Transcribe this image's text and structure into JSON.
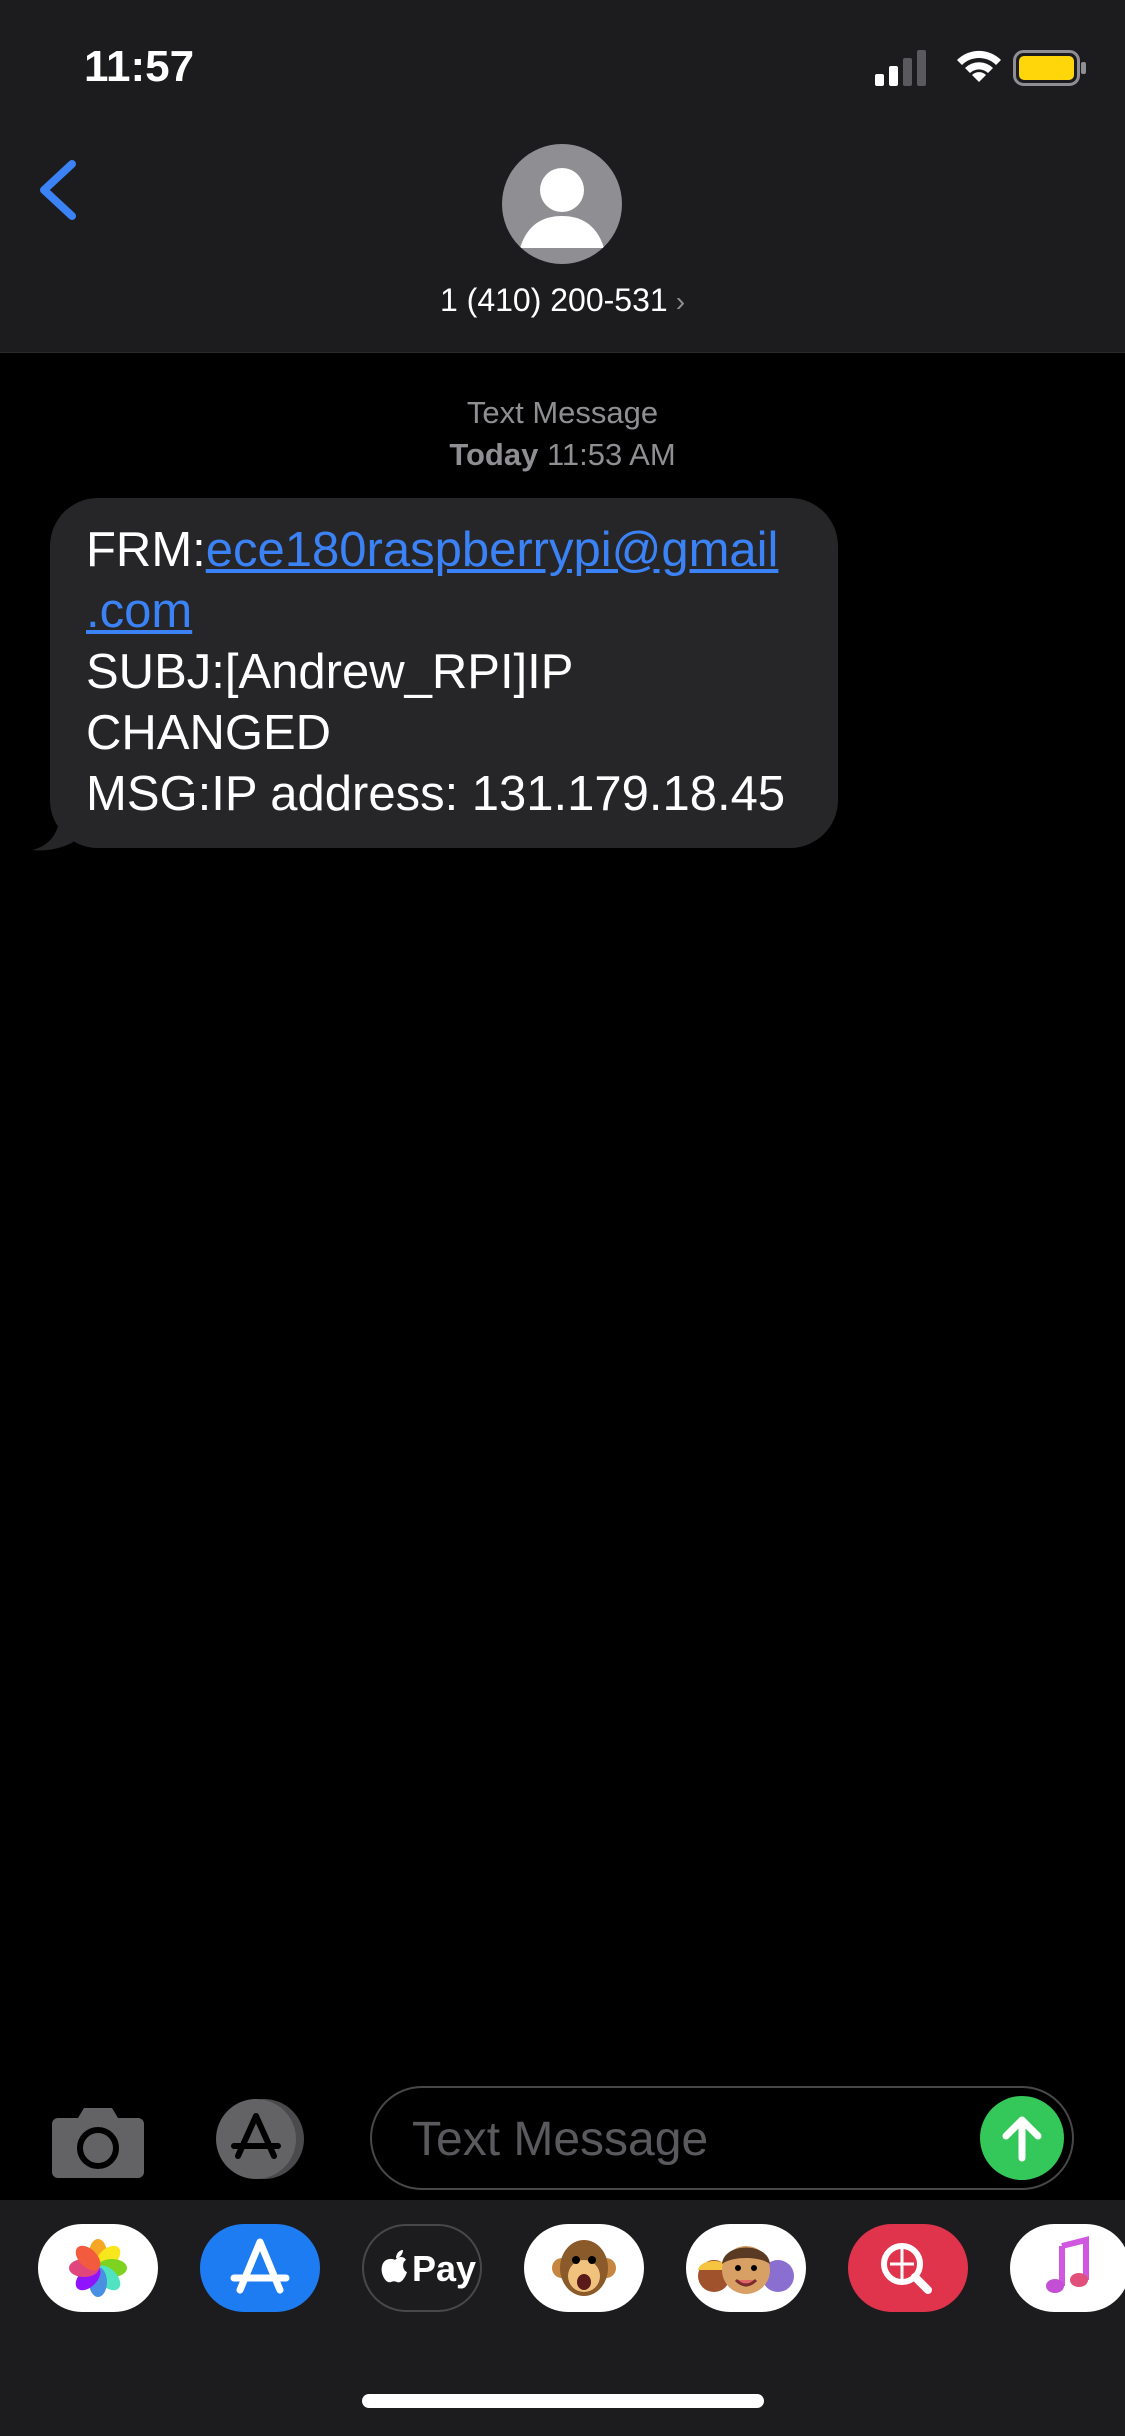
{
  "status_bar": {
    "time": "11:57"
  },
  "contact": {
    "name": "1 (410) 200-531",
    "chevron": "›"
  },
  "conversation": {
    "timestamp_type": "Text Message",
    "timestamp_day": "Today",
    "timestamp_time": "11:53 AM",
    "message": {
      "from_label": "FRM:",
      "from_email_part1": "ece180raspberrypi@gmail",
      "from_email_part2": ".com",
      "subject_line1": "SUBJ:[Andrew_RPI]IP",
      "subject_line2": "CHANGED",
      "msg_line": "MSG:IP address: 131.179.18.45"
    }
  },
  "composer": {
    "placeholder": "Text Message"
  },
  "app_drawer": {
    "apps": [
      "photos-icon",
      "app-store-icon",
      "apple-pay-icon",
      "animoji-icon",
      "memoji-icon",
      "web-search-icon",
      "music-icon"
    ],
    "apple_pay_label": "Pay"
  },
  "colors": {
    "accent": "#3b82f6",
    "send": "#34c759",
    "bubble": "#262628",
    "header": "#1c1c1e"
  }
}
